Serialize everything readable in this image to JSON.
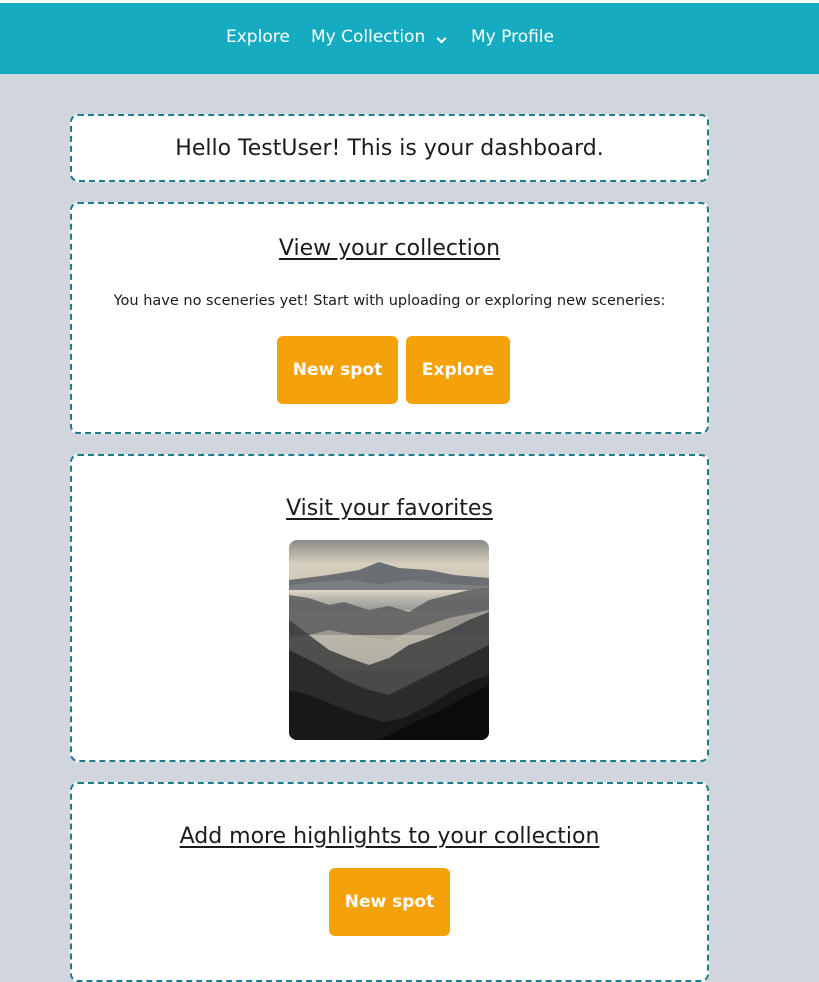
{
  "nav": {
    "links": [
      {
        "label": "Explore"
      },
      {
        "label": "My Collection"
      },
      {
        "label": "My Profile"
      }
    ]
  },
  "dashboard": {
    "greeting": "Hello TestUser! This is your dashboard."
  },
  "collection": {
    "title": "View your collection",
    "empty_message": "You have no sceneries yet! Start with uploading or exploring new sceneries:",
    "new_spot_label": "New spot",
    "explore_label": "Explore"
  },
  "favorites": {
    "title": "Visit your favorites"
  },
  "highlights": {
    "title": "Add more highlights to your collection",
    "new_spot_label": "New spot"
  },
  "colors": {
    "navbar": "#15abc0",
    "page_background": "#d1d5de",
    "button": "#f5a20a",
    "card_border": "#1a7c8c"
  }
}
